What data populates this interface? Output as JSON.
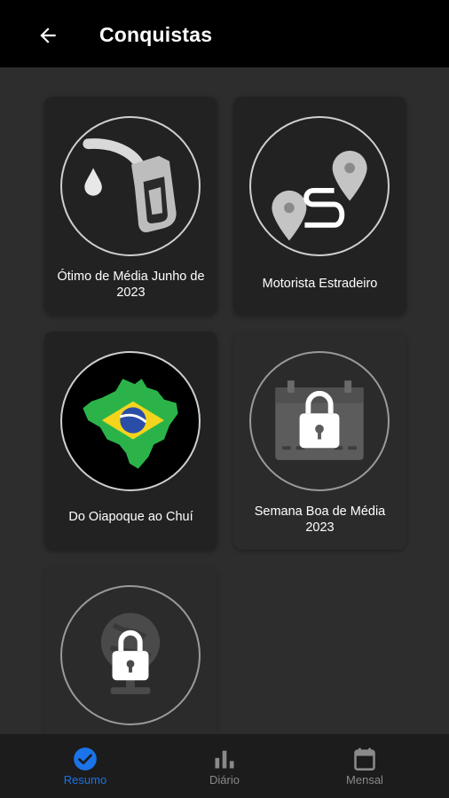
{
  "header": {
    "title": "Conquistas"
  },
  "achievements": [
    {
      "label": "Ótimo de Média Junho de 2023",
      "locked": false
    },
    {
      "label": "Motorista Estradeiro",
      "locked": false
    },
    {
      "label": "Do Oiapoque ao Chuí",
      "locked": false
    },
    {
      "label": "Semana Boa de Média 2023",
      "locked": true
    },
    {
      "label": "",
      "locked": true
    }
  ],
  "bottom_nav": {
    "items": [
      {
        "label": "Resumo",
        "icon": "check-circle-icon",
        "active": true
      },
      {
        "label": "Diário",
        "icon": "bar-chart-icon",
        "active": false
      },
      {
        "label": "Mensal",
        "icon": "calendar-icon",
        "active": false
      }
    ]
  },
  "colors": {
    "accent": "#1a73e8",
    "header_bg": "#000000",
    "page_bg": "#2d2d2d"
  }
}
